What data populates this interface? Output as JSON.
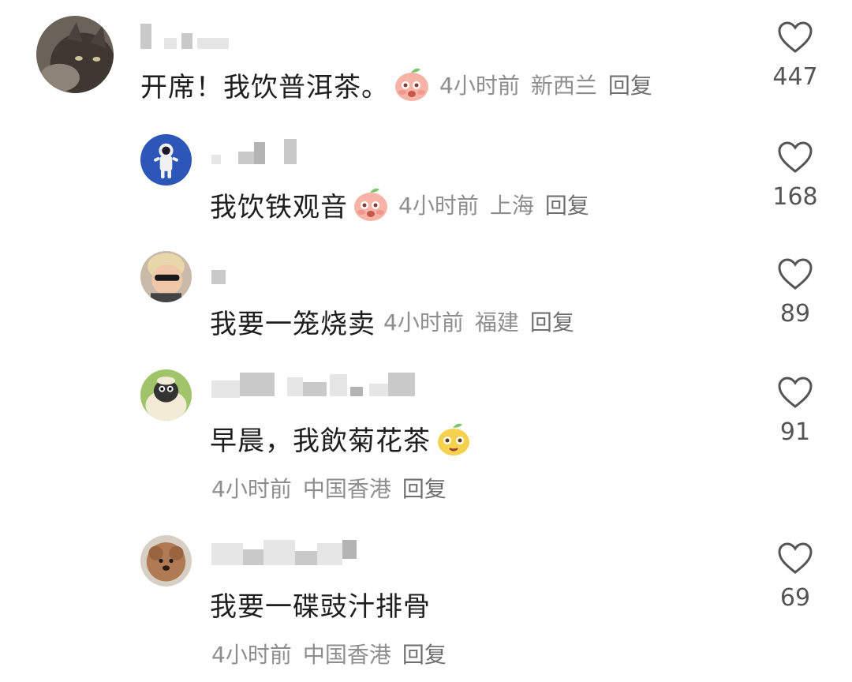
{
  "comments": [
    {
      "text": "开席！我饮普洱茶。",
      "time": "4小时前",
      "location": "新西兰",
      "reply_label": "回复",
      "likes": "447",
      "avatar": "cat-avatar",
      "emoji": "peach-shy-emoji"
    },
    {
      "text": "我饮铁观音",
      "time": "4小时前",
      "location": "上海",
      "reply_label": "回复",
      "likes": "168",
      "avatar": "astronaut-avatar",
      "emoji": "peach-shy-emoji"
    },
    {
      "text": "我要一笼烧卖",
      "time": "4小时前",
      "location": "福建",
      "reply_label": "回复",
      "likes": "89",
      "avatar": "child-sunglasses-avatar"
    },
    {
      "text": "早晨，我飲菊花茶",
      "time": "4小时前",
      "location": "中国香港",
      "reply_label": "回复",
      "likes": "91",
      "avatar": "sheep-avatar",
      "emoji": "yellow-pear-emoji"
    },
    {
      "text": "我要一碟豉汁排骨",
      "time": "4小时前",
      "location": "中国香港",
      "reply_label": "回复",
      "likes": "69",
      "avatar": "dog-avatar"
    }
  ],
  "colors": {
    "meta_text": "#8e8e8e",
    "body_text": "#1e1e1e",
    "heart_stroke": "#555555"
  }
}
